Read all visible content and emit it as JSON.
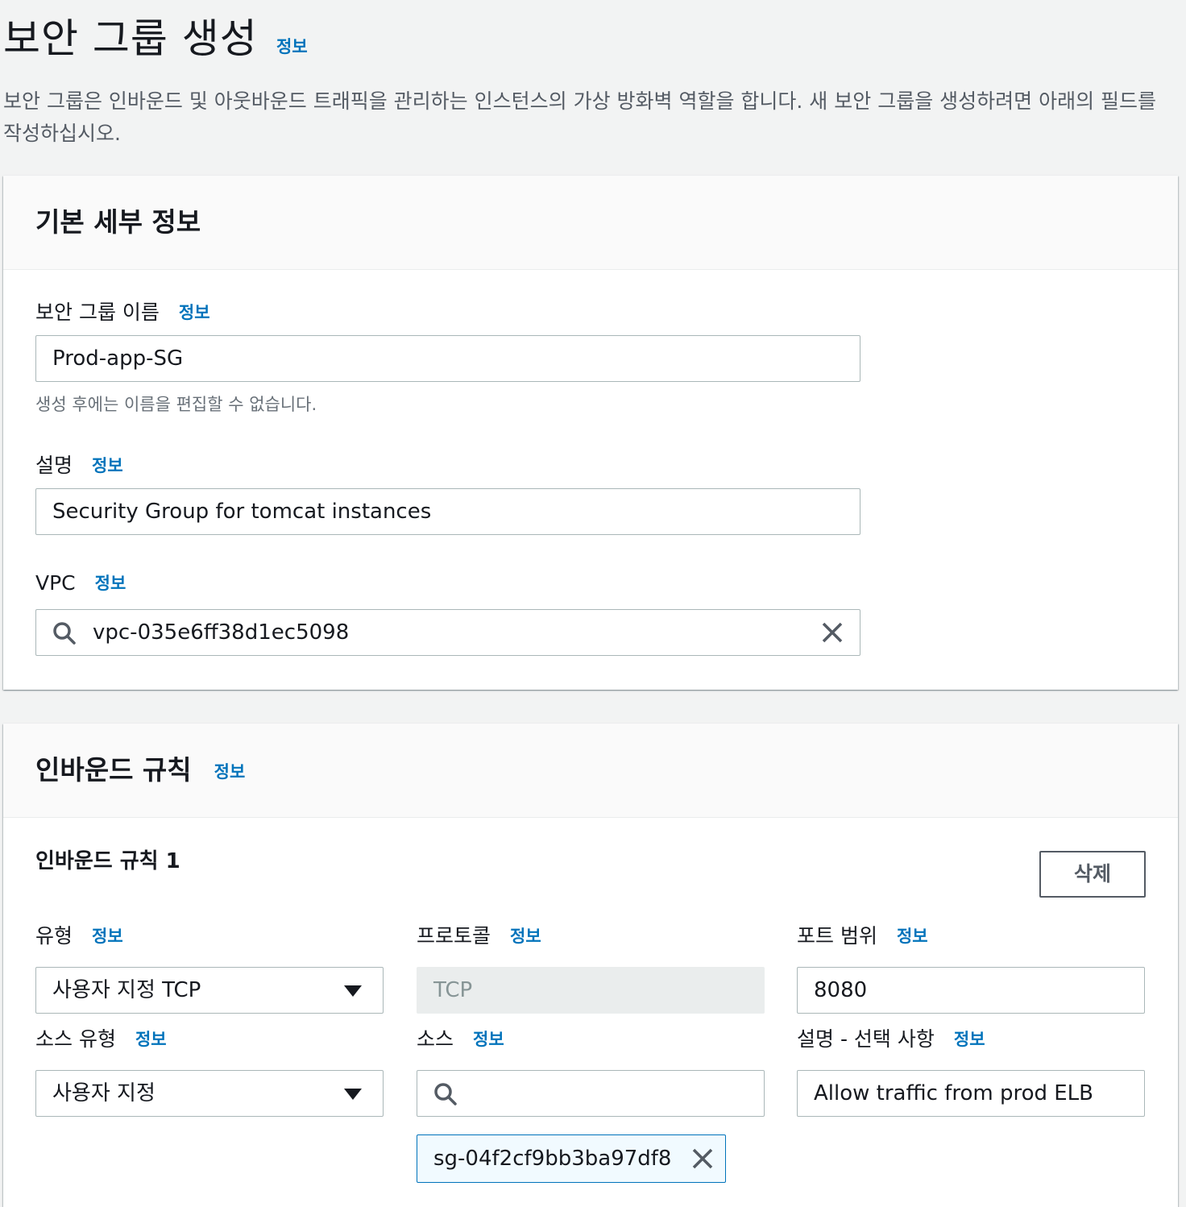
{
  "page": {
    "title": "보안 그룹 생성",
    "info": "정보",
    "description": "보안 그룹은 인바운드 및 아웃바운드 트래픽을 관리하는 인스턴스의 가상 방화벽 역할을 합니다. 새 보안 그룹을 생성하려면 아래의 필드를 작성하십시오."
  },
  "basic": {
    "title": "기본 세부 정보",
    "name_label": "보안 그룹 이름",
    "name_value": "Prod-app-SG",
    "name_hint": "생성 후에는 이름을 편집할 수 없습니다.",
    "desc_label": "설명",
    "desc_value": "Security Group for tomcat instances",
    "vpc_label": "VPC",
    "vpc_value": "vpc-035e6ff38d1ec5098",
    "info": "정보"
  },
  "inbound": {
    "title": "인바운드 규칙",
    "info": "정보",
    "rule_title": "인바운드 규칙 1",
    "delete_label": "삭제",
    "type_label": "유형",
    "type_value": "사용자 지정 TCP",
    "protocol_label": "프로토콜",
    "protocol_value": "TCP",
    "port_label": "포트 범위",
    "port_value": "8080",
    "source_type_label": "소스 유형",
    "source_type_value": "사용자 지정",
    "source_label": "소스",
    "source_value": "",
    "source_token": "sg-04f2cf9bb3ba97df8",
    "rule_desc_label": "설명 - 선택 사항",
    "rule_desc_value": "Allow traffic from prod ELB"
  },
  "colors": {
    "link": "#0073bb",
    "background": "#f2f3f3",
    "border": "#aab7b8"
  },
  "icons": {
    "search": "search-icon",
    "clear": "close-icon",
    "dropdown": "caret-down-icon",
    "remove_token": "close-icon"
  }
}
